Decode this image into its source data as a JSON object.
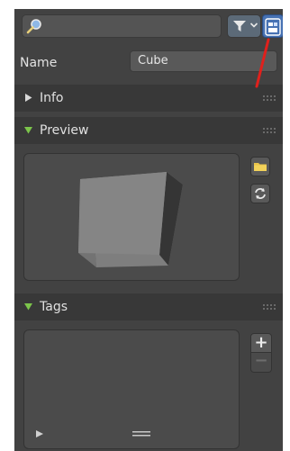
{
  "toolbar": {
    "search_icon": "magnifier-icon",
    "filter_icon": "filter-funnel-icon",
    "filter_dropdown_icon": "chevron-down-icon",
    "asset_toggle_icon": "asset-browser-icon"
  },
  "name": {
    "label": "Name",
    "value": "Cube"
  },
  "sections": {
    "info": {
      "title": "Info",
      "expanded": false
    },
    "preview": {
      "title": "Preview",
      "expanded": true
    },
    "tags": {
      "title": "Tags",
      "expanded": true
    }
  },
  "preview": {
    "load_icon": "folder-icon",
    "generate_icon": "refresh-icon"
  },
  "tags": {
    "add_label": "+",
    "remove_label": "−",
    "items": []
  },
  "colors": {
    "panel_bg": "#424242",
    "header_bg": "#383838",
    "accent_blue": "#4772b3",
    "expanded_triangle": "#7cc54b",
    "annotation_red": "#e0201c"
  }
}
